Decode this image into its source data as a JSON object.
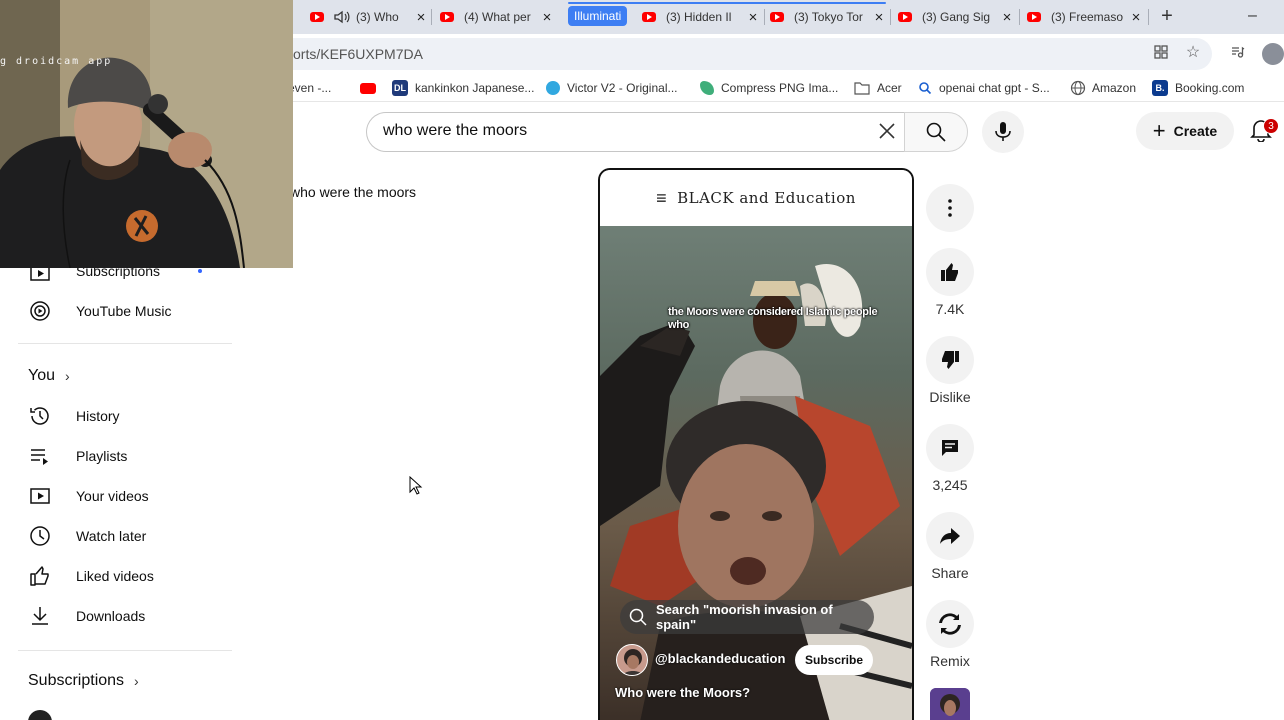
{
  "browser": {
    "tabs": [
      {
        "label": "(3) Who"
      },
      {
        "label": "(4) What per"
      },
      {
        "label": "(3) Hidden Il"
      },
      {
        "label": "(3) Tokyo Tor"
      },
      {
        "label": "(3) Gang Sig"
      },
      {
        "label": "(3) Freemaso"
      }
    ],
    "tab_group_label": "Illuminati",
    "url": "orts/KEF6UXPM7DA",
    "bookmarks": [
      {
        "label": "even -..."
      },
      {
        "label": "kankinkon Japanese..."
      },
      {
        "label": "Victor V2 - Original..."
      },
      {
        "label": "Compress PNG Ima..."
      },
      {
        "label": "Acer"
      },
      {
        "label": "openai chat gpt - S..."
      },
      {
        "label": "Amazon"
      },
      {
        "label": "Booking.com"
      }
    ],
    "bookmark_badges": {
      "dl": "DL",
      "booking": "B."
    }
  },
  "webcam": {
    "overlay_text": "g droidcam app"
  },
  "youtube": {
    "search": {
      "value": "who were the moors",
      "placeholder": "Search"
    },
    "create_label": "Create",
    "notification_count": "3",
    "search_chip": "who were the moors"
  },
  "sidebar": {
    "items_top": [
      {
        "label": "Subscriptions",
        "icon": "subscriptions-icon"
      },
      {
        "label": "YouTube Music",
        "icon": "youtube-music-icon"
      }
    ],
    "you_header": "You",
    "you_items": [
      {
        "label": "History",
        "icon": "history-icon"
      },
      {
        "label": "Playlists",
        "icon": "playlists-icon"
      },
      {
        "label": "Your videos",
        "icon": "your-videos-icon"
      },
      {
        "label": "Watch later",
        "icon": "watch-later-icon"
      },
      {
        "label": "Liked videos",
        "icon": "liked-videos-icon"
      },
      {
        "label": "Downloads",
        "icon": "downloads-icon"
      }
    ],
    "subscriptions_header": "Subscriptions"
  },
  "short": {
    "header_title": "BLACK and Education",
    "caption": "the Moors were considered Islamic people who",
    "search_pill": "Search \"moorish invasion of spain\"",
    "channel": "@blackandeducation",
    "subscribe_label": "Subscribe",
    "title": "Who were the Moors?"
  },
  "actions": {
    "likes": "7.4K",
    "dislike_label": "Dislike",
    "comments": "3,245",
    "share_label": "Share",
    "remix_label": "Remix"
  },
  "colors": {
    "youtube_red": "#ff0000",
    "tab_group_blue": "#3d7ef3",
    "notification_red": "#cc0000"
  }
}
